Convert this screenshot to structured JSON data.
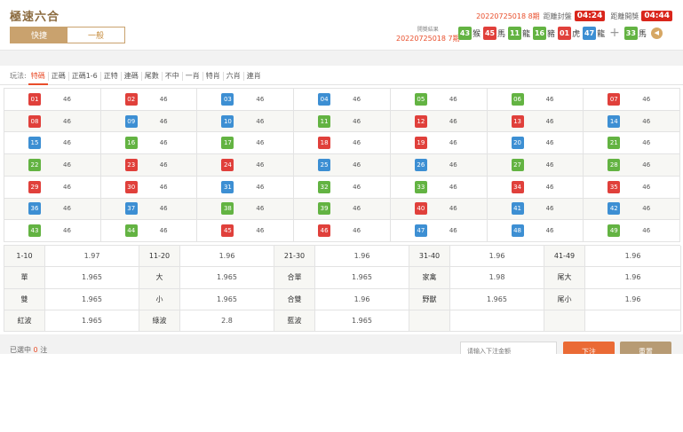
{
  "header": {
    "title": "極速六合",
    "modes": [
      {
        "label": "快捷",
        "active": true
      },
      {
        "label": "一般",
        "active": false
      }
    ],
    "next_period": "20220725018 8期",
    "close_label": "距離封盤",
    "close_timer": "04:24",
    "draw_label": "距離開獎",
    "draw_timer": "04:44"
  },
  "last_result": {
    "label": "開獎結果",
    "period": "20220725018 7期",
    "balls": [
      {
        "num": "43",
        "color": "green",
        "zodiac": "猴"
      },
      {
        "num": "45",
        "color": "red",
        "zodiac": "馬"
      },
      {
        "num": "11",
        "color": "green",
        "zodiac": "龍"
      },
      {
        "num": "16",
        "color": "green",
        "zodiac": "豬"
      },
      {
        "num": "01",
        "color": "red",
        "zodiac": "虎"
      },
      {
        "num": "47",
        "color": "blue",
        "zodiac": "龍"
      }
    ],
    "special": {
      "num": "33",
      "color": "green",
      "zodiac": "馬"
    },
    "plus": "+",
    "sound_icon": "speaker-icon"
  },
  "play_tabs": {
    "label": "玩法:",
    "items": [
      {
        "label": "特碼",
        "active": true
      },
      {
        "label": "正碼",
        "active": false
      },
      {
        "label": "正碼1-6",
        "active": false
      },
      {
        "label": "正特",
        "active": false
      },
      {
        "label": "連碼",
        "active": false
      },
      {
        "label": "尾數",
        "active": false
      },
      {
        "label": "不中",
        "active": false
      },
      {
        "label": "一肖",
        "active": false
      },
      {
        "label": "特肖",
        "active": false
      },
      {
        "label": "六肖",
        "active": false
      },
      {
        "label": "連肖",
        "active": false
      }
    ]
  },
  "numbers": {
    "odds": "46",
    "colors": {
      "red": "#e0403b",
      "blue": "#3d8fd3",
      "green": "#63b342"
    },
    "items": [
      {
        "num": "01",
        "color": "red"
      },
      {
        "num": "02",
        "color": "red"
      },
      {
        "num": "03",
        "color": "blue"
      },
      {
        "num": "04",
        "color": "blue"
      },
      {
        "num": "05",
        "color": "green"
      },
      {
        "num": "06",
        "color": "green"
      },
      {
        "num": "07",
        "color": "red"
      },
      {
        "num": "08",
        "color": "red"
      },
      {
        "num": "09",
        "color": "blue"
      },
      {
        "num": "10",
        "color": "blue"
      },
      {
        "num": "11",
        "color": "green"
      },
      {
        "num": "12",
        "color": "red"
      },
      {
        "num": "13",
        "color": "red"
      },
      {
        "num": "14",
        "color": "blue"
      },
      {
        "num": "15",
        "color": "blue"
      },
      {
        "num": "16",
        "color": "green"
      },
      {
        "num": "17",
        "color": "green"
      },
      {
        "num": "18",
        "color": "red"
      },
      {
        "num": "19",
        "color": "red"
      },
      {
        "num": "20",
        "color": "blue"
      },
      {
        "num": "21",
        "color": "green"
      },
      {
        "num": "22",
        "color": "green"
      },
      {
        "num": "23",
        "color": "red"
      },
      {
        "num": "24",
        "color": "red"
      },
      {
        "num": "25",
        "color": "blue"
      },
      {
        "num": "26",
        "color": "blue"
      },
      {
        "num": "27",
        "color": "green"
      },
      {
        "num": "28",
        "color": "green"
      },
      {
        "num": "29",
        "color": "red"
      },
      {
        "num": "30",
        "color": "red"
      },
      {
        "num": "31",
        "color": "blue"
      },
      {
        "num": "32",
        "color": "green"
      },
      {
        "num": "33",
        "color": "green"
      },
      {
        "num": "34",
        "color": "red"
      },
      {
        "num": "35",
        "color": "red"
      },
      {
        "num": "36",
        "color": "blue"
      },
      {
        "num": "37",
        "color": "blue"
      },
      {
        "num": "38",
        "color": "green"
      },
      {
        "num": "39",
        "color": "green"
      },
      {
        "num": "40",
        "color": "red"
      },
      {
        "num": "41",
        "color": "blue"
      },
      {
        "num": "42",
        "color": "blue"
      },
      {
        "num": "43",
        "color": "green"
      },
      {
        "num": "44",
        "color": "green"
      },
      {
        "num": "45",
        "color": "red"
      },
      {
        "num": "46",
        "color": "red"
      },
      {
        "num": "47",
        "color": "blue"
      },
      {
        "num": "48",
        "color": "blue"
      },
      {
        "num": "49",
        "color": "green"
      }
    ]
  },
  "combos": [
    [
      {
        "label": "1-10",
        "odds": "1.97"
      },
      {
        "label": "11-20",
        "odds": "1.96"
      },
      {
        "label": "21-30",
        "odds": "1.96"
      },
      {
        "label": "31-40",
        "odds": "1.96"
      },
      {
        "label": "41-49",
        "odds": "1.96"
      }
    ],
    [
      {
        "label": "單",
        "odds": "1.965"
      },
      {
        "label": "大",
        "odds": "1.965"
      },
      {
        "label": "合單",
        "odds": "1.965"
      },
      {
        "label": "家禽",
        "odds": "1.98"
      },
      {
        "label": "尾大",
        "odds": "1.96"
      }
    ],
    [
      {
        "label": "雙",
        "odds": "1.965"
      },
      {
        "label": "小",
        "odds": "1.965"
      },
      {
        "label": "合雙",
        "odds": "1.96"
      },
      {
        "label": "野獸",
        "odds": "1.965"
      },
      {
        "label": "尾小",
        "odds": "1.96"
      }
    ],
    [
      {
        "label": "紅波",
        "odds": "1.965"
      },
      {
        "label": "綠波",
        "odds": "2.8"
      },
      {
        "label": "藍波",
        "odds": "1.965"
      },
      {
        "label": "",
        "odds": ""
      },
      {
        "label": "",
        "odds": ""
      }
    ]
  ],
  "footer": {
    "selected_prefix": "已選中",
    "selected_count": "0",
    "selected_suffix": "注",
    "amount_placeholder": "请输入下注金额",
    "submit_label": "下注",
    "reset_label": "重置"
  }
}
